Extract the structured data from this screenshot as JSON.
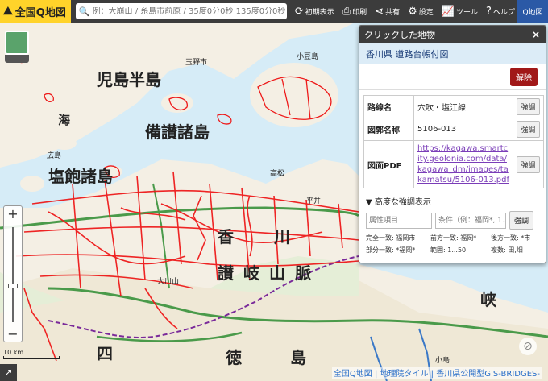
{
  "toolbar": {
    "logo": "全国Q地図",
    "search_placeholder": "例：大崩山 / 糸島市前原 / 35度0分0秒 135度0分0秒",
    "buttons": [
      {
        "icon": "reload-icon",
        "label": "初期表示"
      },
      {
        "icon": "print-icon",
        "label": "印刷"
      },
      {
        "icon": "share-icon",
        "label": "共有"
      },
      {
        "icon": "gear-icon",
        "label": "設定"
      },
      {
        "icon": "tools-icon",
        "label": "ツール"
      },
      {
        "icon": "help-icon",
        "label": "ヘルプ"
      }
    ],
    "qmap_button": "Q地図"
  },
  "map": {
    "labels": {
      "kojima": "児島半島",
      "bisan": "備讃諸島",
      "shiwaku": "塩飽諸島",
      "sea": "海",
      "kagawa": "香川",
      "sanuki": "讃岐山脈",
      "shikoku": "四",
      "tokushima": "徳島",
      "kyo": "峡",
      "tamano": "玉野市",
      "hirai": "平井",
      "ohashi": "大川山",
      "kouma": "小豆島",
      "koshima": "小島",
      "hirose": "広島",
      "takamatsu": "高松"
    },
    "scale_label": "10 km",
    "attribution": "全国Q地図 | 地理院タイル | 香川県公開型GIS-BRIDGES-"
  },
  "panel": {
    "title": "クリックした地物",
    "layer": "香川県 道路台帳付図",
    "release_button": "解除",
    "rows": [
      {
        "key": "路線名",
        "value": "穴吹・塩江線",
        "button": "強調"
      },
      {
        "key": "図郭名称",
        "value": "5106-013",
        "button": "強調"
      },
      {
        "key": "図面PDF",
        "value": "https://kagawa.smartcity.geolonia.com/data/kagawa_dm/images/takamatsu/5106-013.pdf",
        "button": "強調"
      }
    ],
    "advanced_title": "▼ 高度な強調表示",
    "attr_placeholder": "属性項目",
    "cond_placeholder": "条件（例：福岡*, 1...",
    "apply_button": "強調",
    "help": [
      "完全一致: 福岡市",
      "前方一致: 福岡*",
      "後方一致: *市",
      "部分一致: *福岡*",
      "範囲: 1...50",
      "複数: 田,畑"
    ]
  }
}
